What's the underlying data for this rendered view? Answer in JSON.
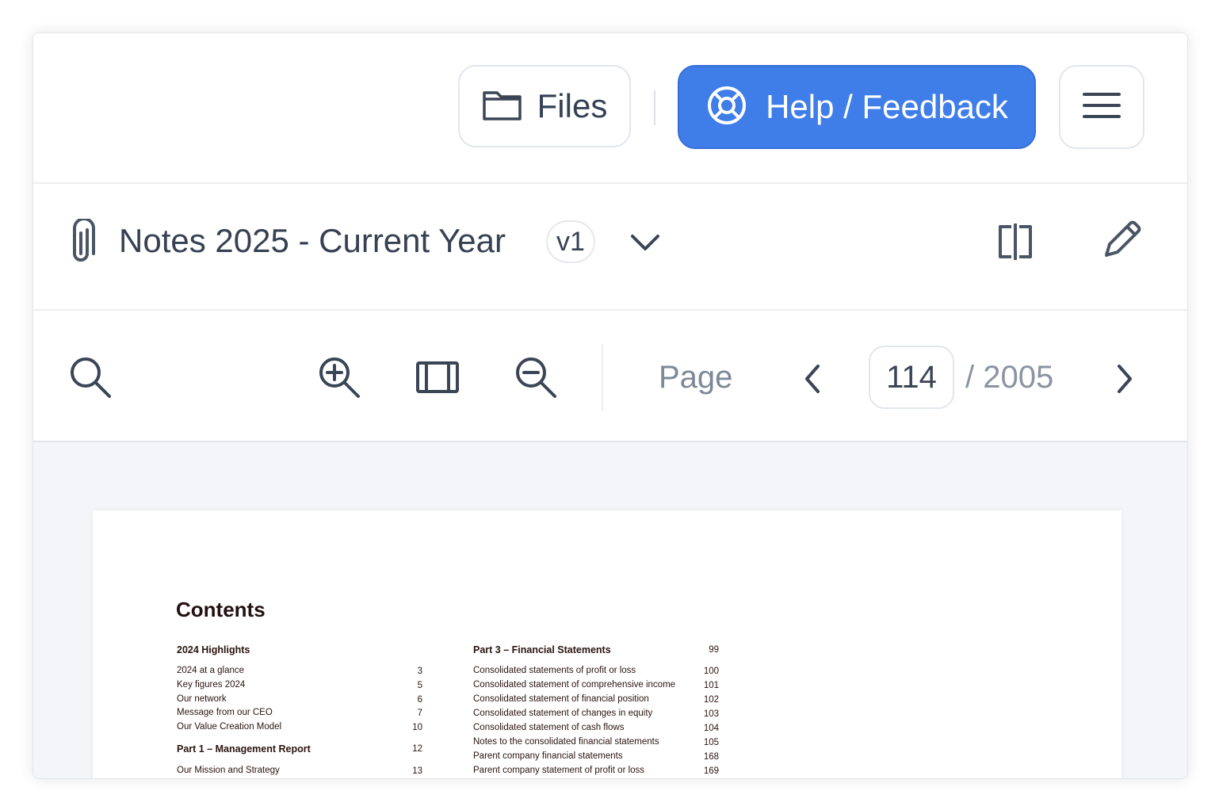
{
  "header": {
    "files_label": "Files",
    "help_label": "Help / Feedback"
  },
  "document": {
    "title": "Notes 2025 - Current Year",
    "version": "v1"
  },
  "toolbar": {
    "page_label": "Page",
    "current_page": "114",
    "total_pages": "/ 2005"
  },
  "colors": {
    "accent": "#3f7ee8",
    "text": "#364152",
    "muted": "#7d8898"
  },
  "icons": {
    "files": "folder-icon",
    "help": "lifebuoy-icon",
    "menu": "hamburger-menu-icon",
    "attachment": "paperclip-icon",
    "dropdown": "chevron-down-icon",
    "compare": "compare-columns-icon",
    "edit": "pencil-icon",
    "search": "search-icon",
    "zoom_in": "zoom-in-icon",
    "fit": "fit-width-icon",
    "zoom_out": "zoom-out-icon",
    "prev": "chevron-left-icon",
    "next": "chevron-right-icon"
  },
  "pdf": {
    "heading": "Contents",
    "left_sections": [
      {
        "label": "2024 Highlights",
        "page": "",
        "bold": true
      },
      {
        "label": "2024 at a glance",
        "page": "3",
        "bold": false
      },
      {
        "label": "Key figures 2024",
        "page": "5",
        "bold": false
      },
      {
        "label": "Our network",
        "page": "6",
        "bold": false
      },
      {
        "label": "Message from our CEO",
        "page": "7",
        "bold": false
      },
      {
        "label": "Our Value Creation Model",
        "page": "10",
        "bold": false
      },
      {
        "label": "Part 1 – Management Report",
        "page": "12",
        "bold": true
      },
      {
        "label": "Our Mission and Strategy",
        "page": "13",
        "bold": false
      }
    ],
    "right_sections": [
      {
        "label": "Part 3 – Financial Statements",
        "page": "99",
        "bold": true
      },
      {
        "label": "Consolidated statements of profit or loss",
        "page": "100",
        "bold": false
      },
      {
        "label": "Consolidated statement of comprehensive income",
        "page": "101",
        "bold": false
      },
      {
        "label": "Consolidated statement of financial position",
        "page": "102",
        "bold": false
      },
      {
        "label": "Consolidated statement of changes in equity",
        "page": "103",
        "bold": false
      },
      {
        "label": "Consolidated statement of cash flows",
        "page": "104",
        "bold": false
      },
      {
        "label": "Notes to the consolidated financial statements",
        "page": "105",
        "bold": false
      },
      {
        "label": "Parent company financial statements",
        "page": "168",
        "bold": false
      },
      {
        "label": "Parent company statement of profit or loss",
        "page": "169",
        "bold": false
      }
    ]
  }
}
